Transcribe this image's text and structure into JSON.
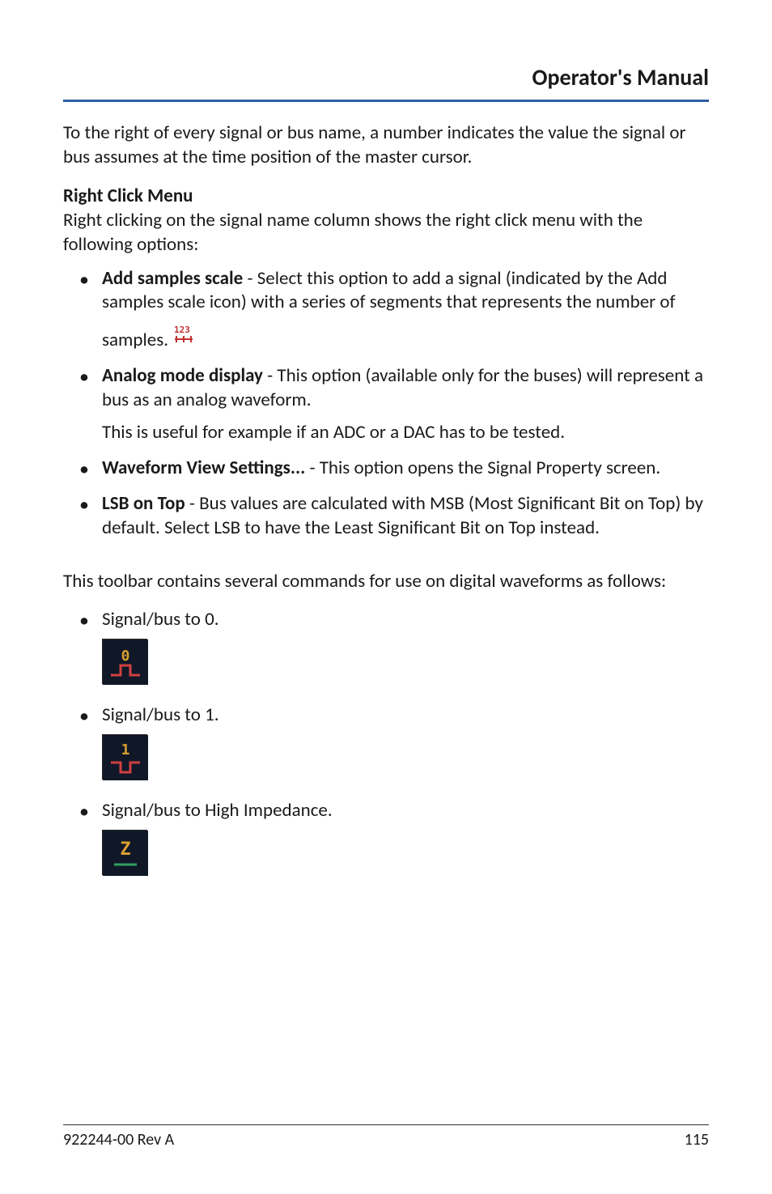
{
  "header": {
    "title": "Operator's Manual"
  },
  "intro": "To the right of every signal or bus name, a number indicates the value the signal or bus assumes at the time position of the master cursor.",
  "rcm": {
    "heading": "Right Click Menu",
    "lead": "Right clicking on the signal name column shows the right click menu with the following options:",
    "items": [
      {
        "bold": "Add samples scale",
        "rest": " - Select this option to add a signal (indicated by the Add samples scale icon) with a series of segments that represents the number of samples."
      },
      {
        "bold": "Analog mode display",
        "rest": " - This option (available only for the buses) will represent a bus as an analog waveform.",
        "sub": "This is useful for example if an ADC or a DAC has to be tested."
      },
      {
        "bold": "Waveform View Settings...",
        "rest": " - This option opens the Signal Property screen."
      },
      {
        "bold": "LSB on Top",
        "rest": " - Bus values are calculated with MSB (Most Significant Bit on Top) by default. Select LSB to have the Least Significant Bit on Top instead."
      }
    ]
  },
  "toolbar": {
    "lead": "This toolbar contains several commands for use on digital waveforms as follows:",
    "items": [
      {
        "label": "Signal/bus to 0."
      },
      {
        "label": "Signal/bus to 1."
      },
      {
        "label": "Signal/bus to High Impedance."
      }
    ]
  },
  "footer": {
    "doc": "922244-00 Rev A",
    "page": "115"
  }
}
